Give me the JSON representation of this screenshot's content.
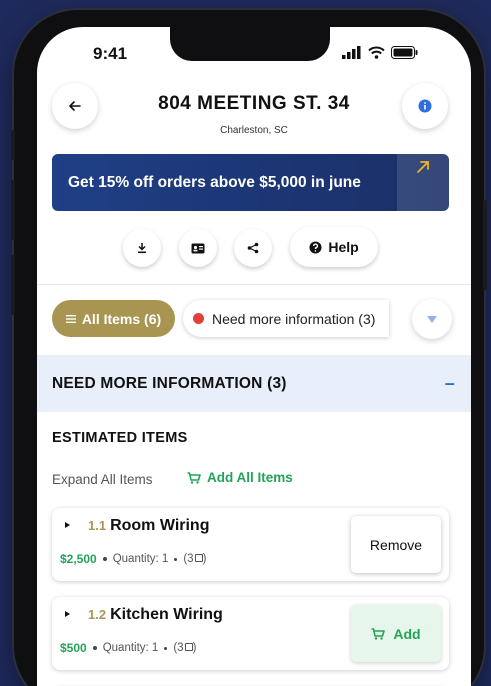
{
  "status": {
    "time": "9:41"
  },
  "header": {
    "title": "804 MEETING ST. 34",
    "subtitle": "Charleston, SC"
  },
  "promo": {
    "text": "Get 15% off orders above $5,000 in june"
  },
  "actions": {
    "help_label": "Help"
  },
  "filters": {
    "all_label": "All Items (6)",
    "need_info_label": "Need more information (3)"
  },
  "section": {
    "title": "NEED MORE INFORMATION (3)",
    "collapse_symbol": "–"
  },
  "estimated": {
    "title": "ESTIMATED ITEMS",
    "expand_label": "Expand All Items",
    "add_all_label": "Add All Items"
  },
  "items": [
    {
      "number": "1.1",
      "name": "Room Wiring",
      "price": "$2,500",
      "quantity": "Quantity: 1",
      "docs": "(3",
      "action": "Remove"
    },
    {
      "number": "1.2",
      "name": "Kitchen Wiring",
      "price": "$500",
      "quantity": "Quantity: 1",
      "docs": "(3",
      "action": "Add"
    }
  ],
  "colors": {
    "accent_gold": "#a99552",
    "accent_green": "#23a35a",
    "promo_blue": "#1f3f86",
    "info_blue": "#2d6de0",
    "alert_red": "#e0403a"
  }
}
